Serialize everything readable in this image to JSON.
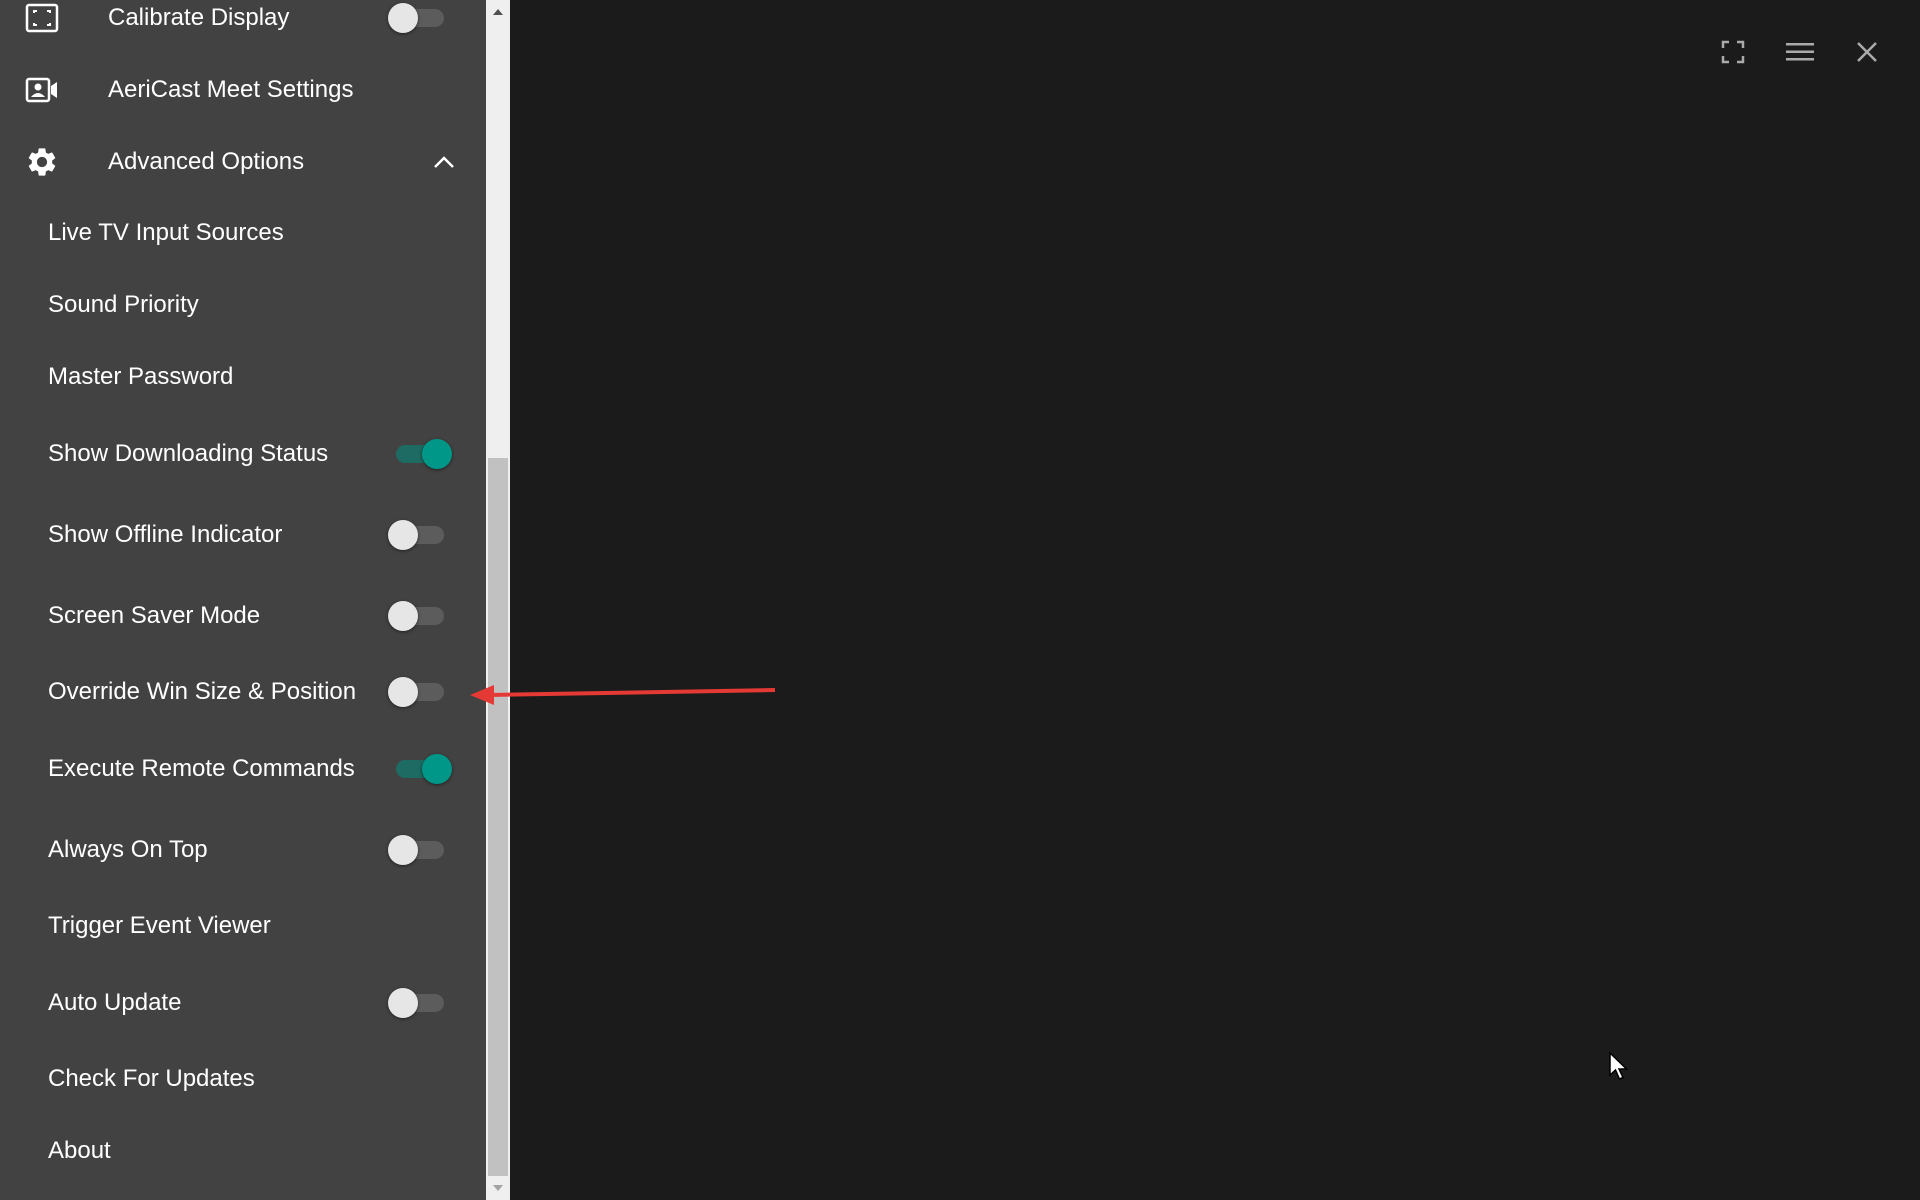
{
  "sidebar": {
    "top_items": [
      {
        "label": "Calibrate Display",
        "icon": "calibrate-display-icon",
        "toggle": false
      },
      {
        "label": "AeriCast Meet Settings",
        "icon": "video-contact-icon"
      },
      {
        "label": "Advanced Options",
        "icon": "gear-icon",
        "expanded": true
      }
    ],
    "advanced_items": [
      {
        "label": "Live TV Input Sources"
      },
      {
        "label": "Sound Priority"
      },
      {
        "label": "Master Password"
      },
      {
        "label": "Show Downloading Status",
        "toggle": true
      },
      {
        "label": "Show Offline Indicator",
        "toggle": false
      },
      {
        "label": "Screen Saver Mode",
        "toggle": false
      },
      {
        "label": "Override Win Size & Position",
        "toggle": false
      },
      {
        "label": "Execute Remote Commands",
        "toggle": true
      },
      {
        "label": "Always On Top",
        "toggle": false
      },
      {
        "label": "Trigger Event Viewer"
      },
      {
        "label": "Auto Update",
        "toggle": false
      },
      {
        "label": "Check For Updates"
      },
      {
        "label": "About"
      }
    ]
  },
  "window_controls": {
    "icons": [
      "fullscreen-icon",
      "menu-icon",
      "close-icon"
    ]
  },
  "colors": {
    "sidebar_bg": "#424242",
    "main_bg": "#1b1b1b",
    "toggle_on": "#009688",
    "annotation": "#e53935"
  }
}
